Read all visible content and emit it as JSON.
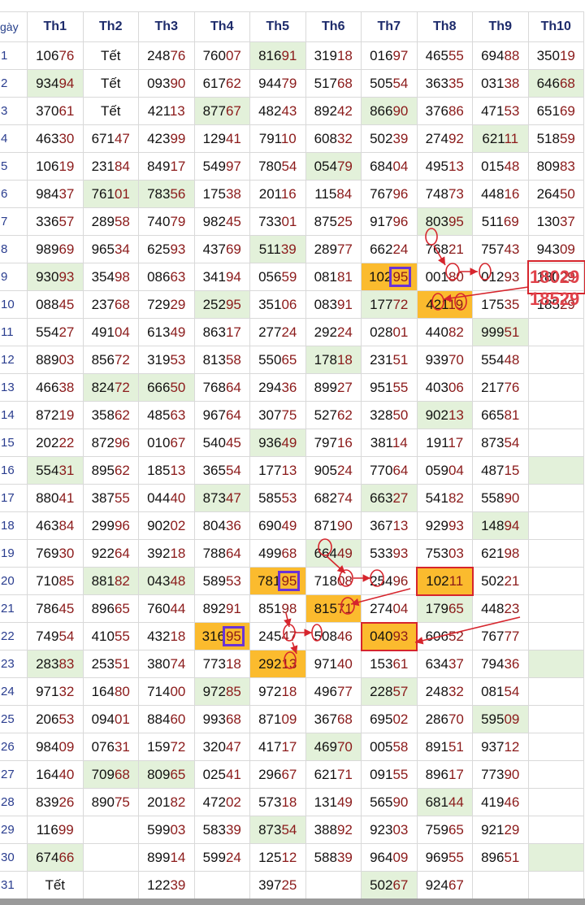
{
  "header": {
    "corner": "gày",
    "months": [
      "Th1",
      "Th2",
      "Th3",
      "Th4",
      "Th5",
      "Th6",
      "Th7",
      "Th8",
      "Th9",
      "Th10"
    ]
  },
  "rows": [
    {
      "day": "1",
      "cells": [
        "10676",
        "Tết",
        "24876",
        "76007",
        "81691",
        "31918",
        "01697",
        "46555",
        "69488",
        "35019"
      ]
    },
    {
      "day": "2",
      "cells": [
        "93494",
        "Tết",
        "09390",
        "61762",
        "94479",
        "51768",
        "50554",
        "36335",
        "03138",
        "64668"
      ]
    },
    {
      "day": "3",
      "cells": [
        "37061",
        "Tết",
        "42113",
        "87767",
        "48243",
        "89242",
        "86690",
        "37686",
        "47153",
        "65169"
      ]
    },
    {
      "day": "4",
      "cells": [
        "46330",
        "67147",
        "42399",
        "12941",
        "79110",
        "60832",
        "50239",
        "27492",
        "62111",
        "51859"
      ]
    },
    {
      "day": "5",
      "cells": [
        "10619",
        "23184",
        "84917",
        "54997",
        "78054",
        "05479",
        "68404",
        "49513",
        "01548",
        "80983"
      ]
    },
    {
      "day": "6",
      "cells": [
        "98437",
        "76101",
        "78356",
        "17538",
        "20116",
        "11584",
        "76796",
        "74873",
        "44816",
        "26450"
      ]
    },
    {
      "day": "7",
      "cells": [
        "33657",
        "28958",
        "74079",
        "98245",
        "73301",
        "87525",
        "91796",
        "80395",
        "51169",
        "13037"
      ]
    },
    {
      "day": "8",
      "cells": [
        "98969",
        "96534",
        "62593",
        "43769",
        "51139",
        "28977",
        "66224",
        "76821",
        "75743",
        "94309"
      ]
    },
    {
      "day": "9",
      "cells": [
        "93093",
        "35498",
        "08663",
        "34194",
        "05659",
        "08181",
        "10295",
        "00180",
        "01293",
        "18029"
      ]
    },
    {
      "day": "10",
      "cells": [
        "08845",
        "23768",
        "72929",
        "25295",
        "35106",
        "08391",
        "17772",
        "42119",
        "17535",
        "18529"
      ]
    },
    {
      "day": "11",
      "cells": [
        "55427",
        "49104",
        "61349",
        "86317",
        "27724",
        "29224",
        "02801",
        "44082",
        "99951",
        ""
      ]
    },
    {
      "day": "12",
      "cells": [
        "88903",
        "85672",
        "31953",
        "81358",
        "55065",
        "17818",
        "23151",
        "93970",
        "55448",
        ""
      ]
    },
    {
      "day": "13",
      "cells": [
        "46638",
        "82472",
        "66650",
        "76864",
        "29436",
        "89927",
        "95155",
        "40306",
        "21776",
        ""
      ]
    },
    {
      "day": "14",
      "cells": [
        "87219",
        "35862",
        "48563",
        "96764",
        "30775",
        "52762",
        "32850",
        "90213",
        "66581",
        ""
      ]
    },
    {
      "day": "15",
      "cells": [
        "20222",
        "87296",
        "01067",
        "54045",
        "93649",
        "79716",
        "38114",
        "19117",
        "87354",
        ""
      ]
    },
    {
      "day": "16",
      "cells": [
        "55431",
        "89562",
        "18513",
        "36554",
        "17713",
        "90524",
        "77064",
        "05904",
        "48715",
        ""
      ]
    },
    {
      "day": "17",
      "cells": [
        "88041",
        "38755",
        "04440",
        "87347",
        "58553",
        "68274",
        "66327",
        "54182",
        "55890",
        ""
      ]
    },
    {
      "day": "18",
      "cells": [
        "46384",
        "29996",
        "90202",
        "80436",
        "69049",
        "87190",
        "36713",
        "92993",
        "14894",
        ""
      ]
    },
    {
      "day": "19",
      "cells": [
        "76930",
        "92264",
        "39218",
        "78864",
        "49968",
        "66449",
        "53393",
        "75303",
        "62198",
        ""
      ]
    },
    {
      "day": "20",
      "cells": [
        "71085",
        "88182",
        "04348",
        "58953",
        "78195",
        "71808",
        "25496",
        "10211",
        "50221",
        ""
      ]
    },
    {
      "day": "21",
      "cells": [
        "78645",
        "89665",
        "76044",
        "89291",
        "85198",
        "81571",
        "27404",
        "17965",
        "44823",
        ""
      ]
    },
    {
      "day": "22",
      "cells": [
        "74954",
        "41055",
        "43218",
        "31695",
        "24547",
        "50846",
        "04093",
        "60652",
        "76777",
        ""
      ]
    },
    {
      "day": "23",
      "cells": [
        "28383",
        "25351",
        "38074",
        "77318",
        "29213",
        "97140",
        "15361",
        "63437",
        "79436",
        ""
      ]
    },
    {
      "day": "24",
      "cells": [
        "97132",
        "16480",
        "71400",
        "97285",
        "97218",
        "49677",
        "22857",
        "24832",
        "08154",
        ""
      ]
    },
    {
      "day": "25",
      "cells": [
        "20653",
        "09401",
        "88460",
        "99368",
        "87109",
        "36768",
        "69502",
        "28670",
        "59509",
        ""
      ]
    },
    {
      "day": "26",
      "cells": [
        "98409",
        "07631",
        "15972",
        "32047",
        "41717",
        "46970",
        "00558",
        "89151",
        "93712",
        ""
      ]
    },
    {
      "day": "27",
      "cells": [
        "16440",
        "70968",
        "80965",
        "02541",
        "29667",
        "62171",
        "09155",
        "89617",
        "77390",
        ""
      ]
    },
    {
      "day": "28",
      "cells": [
        "83926",
        "89075",
        "20182",
        "47202",
        "57318",
        "13149",
        "56590",
        "68144",
        "41946",
        ""
      ]
    },
    {
      "day": "29",
      "cells": [
        "11699",
        "",
        "59903",
        "58339",
        "87354",
        "38892",
        "92303",
        "75965",
        "92129",
        ""
      ]
    },
    {
      "day": "30",
      "cells": [
        "67466",
        "",
        "89914",
        "59924",
        "12512",
        "58839",
        "96409",
        "96955",
        "89651",
        ""
      ]
    },
    {
      "day": "31",
      "cells": [
        "Tết",
        "",
        "12239",
        "",
        "39725",
        "",
        "50267",
        "92467",
        "",
        ""
      ]
    }
  ],
  "highlights": {
    "green_fill": "#e3f1da",
    "orange_fill": "#fbbb2e",
    "purple_box": "#6a33d6",
    "red_mark": "#d6252d"
  },
  "annotations": {
    "big_numbers": [
      "18029",
      "18529"
    ]
  }
}
